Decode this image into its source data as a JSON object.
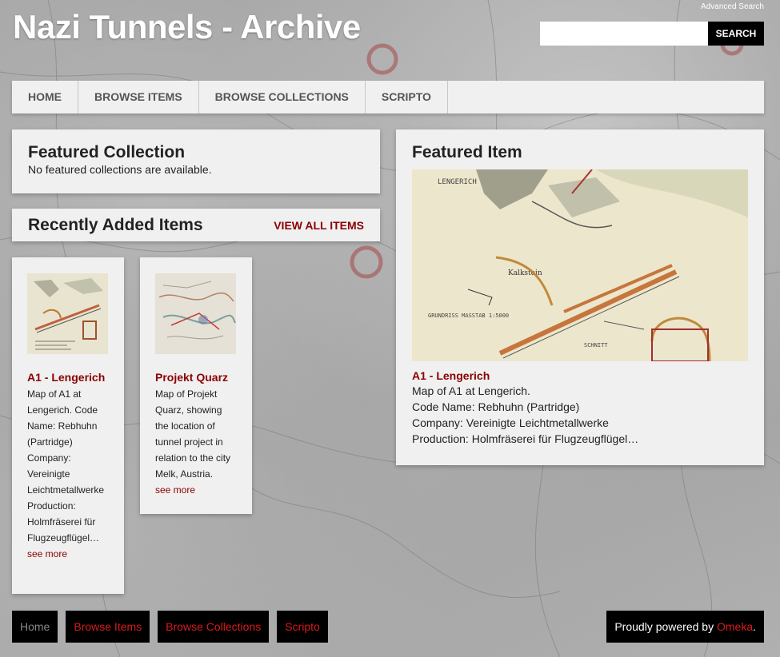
{
  "site": {
    "title": "Nazi Tunnels - Archive",
    "advanced_search": "Advanced Search",
    "search_placeholder": "",
    "search_button": "SEARCH"
  },
  "nav": {
    "items": [
      {
        "label": "HOME"
      },
      {
        "label": "BROWSE ITEMS"
      },
      {
        "label": "BROWSE COLLECTIONS"
      },
      {
        "label": "SCRIPTO"
      }
    ]
  },
  "featured_collection": {
    "heading": "Featured Collection",
    "message": "No featured collections are available."
  },
  "recent": {
    "heading": "Recently Added Items",
    "view_all": "VIEW ALL ITEMS",
    "items": [
      {
        "title": "A1 - Lengerich",
        "description": "Map of A1 at Lengerich. Code Name: Rebhuhn (Partridge) Company: Vereinigte Leichtmetallwerke Production: Holmfräserei für Flugzeugflügel…",
        "see_more": "see more"
      },
      {
        "title": "Projekt Quarz",
        "description": "Map of Projekt Quarz, showing the location of tunnel project in relation to the city Melk, Austria.",
        "see_more": "see more"
      }
    ]
  },
  "featured_item": {
    "heading": "Featured Item",
    "title": "A1 - Lengerich",
    "lines": [
      "Map of A1 at Lengerich.",
      "Code Name: Rebhuhn (Partridge)",
      "Company: Vereinigte Leichtmetallwerke",
      "Production: Holmfräserei für Flugzeugflügel…"
    ],
    "map_labels": {
      "place": "LENGERICH",
      "scale": "GRUNDRISS MASSTAB 1:5000",
      "section": "SCHNITT",
      "limestone": "Kalkstein"
    }
  },
  "footer": {
    "nav": [
      {
        "label": "Home"
      },
      {
        "label": "Browse Items"
      },
      {
        "label": "Browse Collections"
      },
      {
        "label": "Scripto"
      }
    ],
    "powered_prefix": "Proudly powered by ",
    "powered_link": "Omeka",
    "powered_suffix": "."
  },
  "colors": {
    "accent": "#8b0000",
    "footer_link": "#d81b1b",
    "panel_bg": "#f0f0f0"
  }
}
